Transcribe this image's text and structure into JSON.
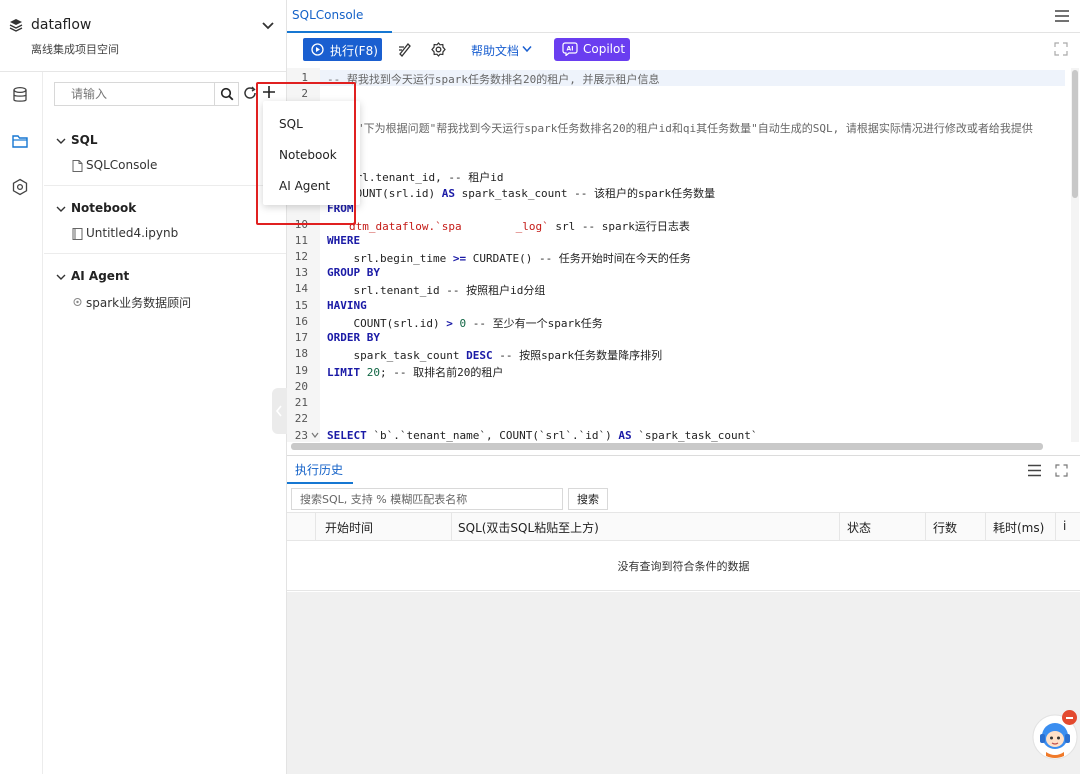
{
  "workspace": {
    "name": "dataflow",
    "subtitle": "离线集成项目空间"
  },
  "sidebar": {
    "search_placeholder": "请输入",
    "groups": [
      {
        "label": "SQL",
        "items": [
          {
            "label": "SQLConsole",
            "icon": "file-icon"
          }
        ]
      },
      {
        "label": "Notebook",
        "items": [
          {
            "label": "Untitled4.ipynb",
            "icon": "notebook-icon"
          }
        ]
      },
      {
        "label": "AI Agent",
        "items": [
          {
            "label": "spark业务数据顾问",
            "icon": "agent-icon"
          }
        ]
      }
    ]
  },
  "new_menu": {
    "items": [
      {
        "label": "SQL"
      },
      {
        "label": "Notebook"
      },
      {
        "label": "AI Agent"
      }
    ],
    "highlight_color": "#e02020"
  },
  "editor_tab": {
    "label": "SQLConsole"
  },
  "toolbar": {
    "run_label": "执行(F8)",
    "help_label": "帮助文档",
    "copilot_label": "Copilot",
    "run_color": "#1a5fd0",
    "copilot_color": "#6a3ef0"
  },
  "editor": {
    "line_numbers": [
      "1",
      "2",
      "",
      "",
      "",
      "",
      "",
      "",
      "",
      "10",
      "11",
      "12",
      "13",
      "14",
      "15",
      "16",
      "17",
      "18",
      "19",
      "20",
      "21",
      "22",
      "23"
    ],
    "lines": {
      "l1": "-- 帮我找到今天运行spark任务数排名20的租户, 并展示租户信息",
      "l3": "\"下为根据问题\"帮我找到今天运行spark任务数排名20的租户id和qi其任务数量\"自动生成的SQL, 请根据实际情况进行修改或者给我提供",
      "l5": "CT",
      "l6": "srl.tenant_id, -- 租户id",
      "l7a": "COUNT(srl.id) ",
      "l7b": "AS",
      "l7c": " spark_task_count -- 该租户的spark任务数量",
      "l8": "FROM",
      "l10a": "dtm_dataflow",
      "l10b": ".`spa",
      "l10c": "_log`",
      "l10d": " srl -- spark运行日志表",
      "l11": "WHERE",
      "l12a": "    srl.begin_time ",
      "l12b": ">=",
      "l12c": " CURDATE() -- 任务开始时间在今天的任务",
      "l13": "GROUP BY",
      "l14": "    srl.tenant_id -- 按照租户id分组",
      "l15": "HAVING",
      "l16a": "    COUNT(srl.id) ",
      "l16b": ">",
      "l16c": " ",
      "l16d": "0",
      "l16e": " -- 至少有一个spark任务",
      "l17": "ORDER BY",
      "l18a": "    spark_task_count ",
      "l18b": "DESC",
      "l18c": " -- 按照spark任务数量降序排列",
      "l19a": "LIMIT",
      "l19b": " ",
      "l19c": "20",
      "l19d": "; -- 取排名前20的租户",
      "l23a": "SELECT",
      "l23b": " `b`.`tenant_name`, COUNT(`srl`.`id`) ",
      "l23c": "AS",
      "l23d": " `spark_task_count`"
    }
  },
  "history": {
    "tab_label": "执行历史",
    "search_placeholder": "搜索SQL, 支持 % 模糊匹配表名称",
    "search_button": "搜索",
    "columns": [
      "开始时间",
      "SQL(双击SQL粘贴至上方)",
      "状态",
      "行数",
      "耗时(ms)",
      "i"
    ],
    "empty_text": "没有查询到符合条件的数据"
  },
  "icons": [
    "layers-icon",
    "chevron-down-icon",
    "database-icon",
    "folder-icon",
    "settings-hex-icon",
    "search-icon",
    "refresh-icon",
    "plus-icon",
    "menu-icon",
    "play-icon",
    "format-icon",
    "gear-icon",
    "copilot-icon",
    "expand-icon",
    "assistant-avatar-icon"
  ]
}
